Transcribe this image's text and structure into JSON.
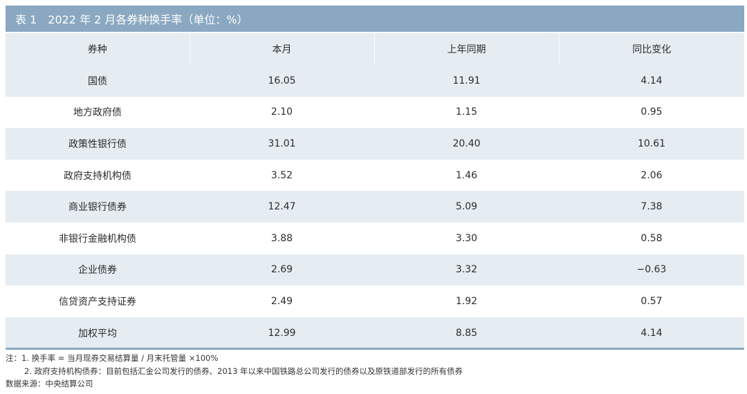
{
  "title": "表 1　2022 年 2 月各券种换手率（单位：%）",
  "headers": [
    "券种",
    "本月",
    "上年同期",
    "同比变化"
  ],
  "rows": [
    [
      "国债",
      "16.05",
      "11.91",
      "4.14"
    ],
    [
      "地方政府债",
      "2.10",
      "1.15",
      "0.95"
    ],
    [
      "政策性银行债",
      "31.01",
      "20.40",
      "10.61"
    ],
    [
      "政府支持机构债",
      "3.52",
      "1.46",
      "2.06"
    ],
    [
      "商业银行债券",
      "12.47",
      "5.09",
      "7.38"
    ],
    [
      "非银行金融机构债",
      "3.88",
      "3.30",
      "0.58"
    ],
    [
      "企业债券",
      "2.69",
      "3.32",
      "−0.63"
    ],
    [
      "信贷资产支持证券",
      "2.49",
      "1.92",
      "0.57"
    ]
  ],
  "total": [
    "加权平均",
    "12.99",
    "8.85",
    "4.14"
  ],
  "notes": {
    "note1": "注：1. 换手率 = 当月现券交易结算量 / 月末托管量 ×100%",
    "note2": "2. 政府支持机构债券：目前包括汇金公司发行的债券、2013 年以来中国铁路总公司发行的债券以及原铁道部发行的所有债券",
    "source": "数据来源：中央结算公司"
  },
  "colors": {
    "header_bar": "#8aa8c1",
    "stripe": "#e5ecf2"
  }
}
